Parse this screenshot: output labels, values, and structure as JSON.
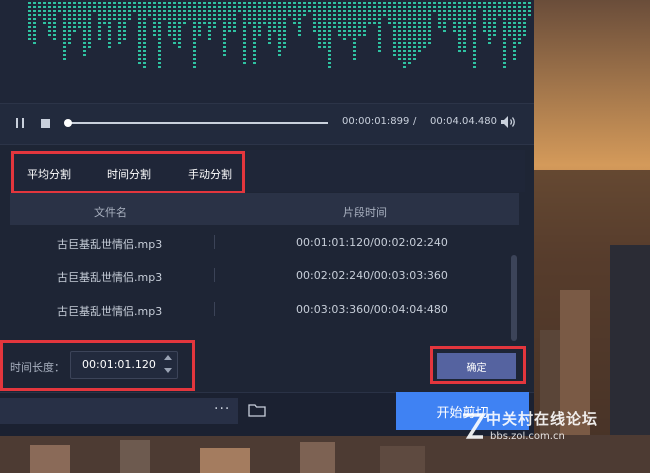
{
  "player": {
    "current_time": "00:00:01:899",
    "separator": "/",
    "total_time": "00:04.04.480"
  },
  "split_tabs": [
    {
      "label": "平均分割"
    },
    {
      "label": "时间分割"
    },
    {
      "label": "手动分割"
    }
  ],
  "table": {
    "headers": [
      "文件名",
      "片段时间"
    ],
    "rows": [
      {
        "name": "古巨基乱世情侣.mp3",
        "time": "00:01:01:120/00:02:02:240"
      },
      {
        "name": "古巨基乱世情侣.mp3",
        "time": "00:02:02:240/00:03:03:360"
      },
      {
        "name": "古巨基乱世情侣.mp3",
        "time": "00:03:03:360/00:04:04:480"
      }
    ]
  },
  "duration": {
    "label": "时间长度：",
    "value": "00:01:01.120"
  },
  "confirm_label": "确定",
  "footer": {
    "more_label": "···",
    "start_cut_label": "开始剪切"
  },
  "watermark": {
    "title": "中关村在线论坛",
    "url": "bbs.zol.com.cn"
  },
  "colors": {
    "highlight": "#e3363d",
    "accent": "#3f82f3",
    "wave": "#2fc3a2"
  },
  "icons": [
    "pause-icon",
    "stop-icon",
    "volume-icon",
    "more-icon",
    "folder-icon",
    "spin-up-icon",
    "spin-down-icon"
  ]
}
